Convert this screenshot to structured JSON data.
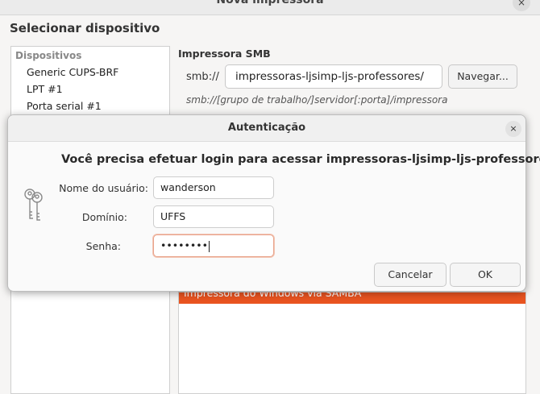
{
  "background_window": {
    "title": "Nova impressora",
    "close_glyph": "×",
    "heading": "Selecionar dispositivo",
    "devices": {
      "header": "Dispositivos",
      "items": [
        "Generic CUPS-BRF",
        "LPT #1",
        "Porta serial #1"
      ]
    },
    "smb": {
      "title": "Impressora SMB",
      "prefix": "smb://",
      "value": "impressoras-ljsimp-ljs-professores/",
      "browse_label": "Navegar...",
      "hint": "smb://[grupo de trabalho/]servidor[:porta]/impressora"
    },
    "connection_selected": "Impressora do Windows via SAMBA",
    "accent_color": "#e95420"
  },
  "dialog": {
    "title": "Autenticação",
    "close_glyph": "×",
    "message": "Você precisa efetuar login para acessar impressoras-ljsimp-ljs-professores.",
    "icon": "keys-icon",
    "fields": {
      "username": {
        "label": "Nome do usuário:",
        "value": "wanderson"
      },
      "domain": {
        "label": "Domínio:",
        "value": "UFFS"
      },
      "password": {
        "label": "Senha:",
        "value": "••••••••"
      }
    },
    "cancel_label": "Cancelar",
    "ok_label": "OK"
  }
}
